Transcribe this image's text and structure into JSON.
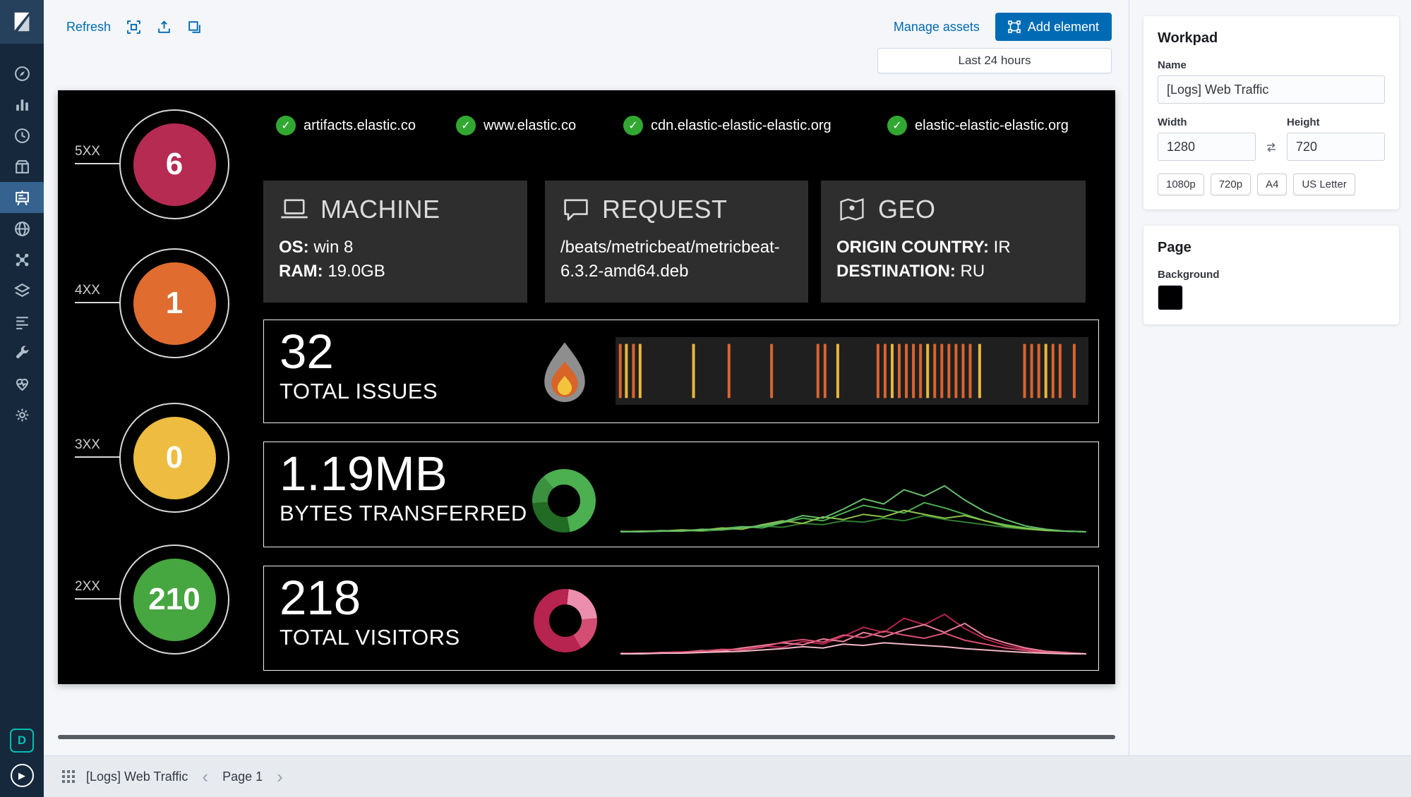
{
  "toolbar": {
    "refresh_label": "Refresh",
    "manage_assets_label": "Manage assets",
    "add_element_label": "Add element",
    "time_filter_label": "Last 24 hours"
  },
  "sidebar": {
    "space_badge": "D",
    "icons": [
      "kibana-logo",
      "discover-compass",
      "visualize-bar-chart",
      "uptime-clock",
      "apm-package",
      "canvas-easel",
      "maps-globe",
      "machine-learning-nodes",
      "infrastructure-layers",
      "logs-lines",
      "dev-tools-wrench",
      "monitoring-heartbeat",
      "management-gear",
      "space-badge-d",
      "play-presentation"
    ]
  },
  "workpad": {
    "status_gauges": [
      {
        "label": "5XX",
        "value": "6",
        "color": "#b62b51"
      },
      {
        "label": "4XX",
        "value": "1",
        "color": "#e06c30"
      },
      {
        "label": "3XX",
        "value": "0",
        "color": "#edbc40"
      },
      {
        "label": "2XX",
        "value": "210",
        "color": "#46a63f"
      }
    ],
    "endpoints": [
      {
        "label": "artifacts.elastic.co"
      },
      {
        "label": "www.elastic.co"
      },
      {
        "label": "cdn.elastic-elastic-elastic.org"
      },
      {
        "label": "elastic-elastic-elastic.org"
      }
    ],
    "cards": [
      {
        "title": "MACHINE",
        "icon": "laptop-icon",
        "lines": [
          {
            "label": "OS:",
            "value": " win 8"
          },
          {
            "label": "RAM:",
            "value": " 19.0GB"
          }
        ]
      },
      {
        "title": "REQUEST",
        "icon": "comment-icon",
        "lines": [
          {
            "label": "",
            "value": "/beats/metricbeat/metricbeat-6.3.2-amd64.deb"
          }
        ]
      },
      {
        "title": "GEO",
        "icon": "map-pin-icon",
        "lines": [
          {
            "label": "ORIGIN COUNTRY:",
            "value": " IR"
          },
          {
            "label": "DESTINATION:",
            "value": " RU"
          }
        ]
      }
    ],
    "metrics": [
      {
        "value": "32",
        "label": "TOTAL ISSUES"
      },
      {
        "value": "1.19MB",
        "label": "BYTES TRANSFERRED"
      },
      {
        "value": "218",
        "label": "TOTAL VISITORS"
      }
    ],
    "bytes_donut": {
      "start_deg": 320,
      "segments": [
        {
          "color": "#4caf50",
          "pct": 58
        },
        {
          "color": "#226b25",
          "pct": 27
        },
        {
          "color": "#3c9140",
          "pct": 15
        }
      ]
    },
    "visitors_donut": {
      "start_deg": 150,
      "segments": [
        {
          "color": "#b6244f",
          "pct": 60
        },
        {
          "color": "#ec8fae",
          "pct": 22
        },
        {
          "color": "#d34e72",
          "pct": 18
        }
      ]
    }
  },
  "right_panel": {
    "workpad_section": {
      "title": "Workpad",
      "name_label": "Name",
      "name_value": "[Logs] Web Traffic",
      "width_label": "Width",
      "width_value": "1280",
      "height_label": "Height",
      "height_value": "720",
      "presets": [
        "1080p",
        "720p",
        "A4",
        "US Letter"
      ]
    },
    "page_section": {
      "title": "Page",
      "background_label": "Background",
      "background_color": "#000000"
    }
  },
  "bottom_bar": {
    "workpad_title": "[Logs] Web Traffic",
    "page_label": "Page 1"
  },
  "chart_data": [
    {
      "type": "bar",
      "title": "HTTP status code counts",
      "categories": [
        "5XX",
        "4XX",
        "3XX",
        "2XX"
      ],
      "values": [
        6,
        1,
        0,
        210
      ]
    },
    {
      "type": "event-ticks",
      "title": "Total issues over last 24 hours",
      "total": 32,
      "x_range_pct": [
        0,
        100
      ],
      "events": [
        {
          "x": 1.0,
          "color": "#d9642e"
        },
        {
          "x": 2.3,
          "color": "#e9b63c"
        },
        {
          "x": 3.8,
          "color": "#d9642e"
        },
        {
          "x": 5.2,
          "color": "#e9b63c"
        },
        {
          "x": 16.5,
          "color": "#e9b63c"
        },
        {
          "x": 24.0,
          "color": "#d9642e"
        },
        {
          "x": 33.0,
          "color": "#d9642e"
        },
        {
          "x": 42.8,
          "color": "#d9642e"
        },
        {
          "x": 44.3,
          "color": "#d9642e"
        },
        {
          "x": 47.0,
          "color": "#e9b63c"
        },
        {
          "x": 55.5,
          "color": "#d9642e"
        },
        {
          "x": 57.0,
          "color": "#d9642e"
        },
        {
          "x": 58.5,
          "color": "#e9b63c"
        },
        {
          "x": 60.0,
          "color": "#d9642e"
        },
        {
          "x": 61.5,
          "color": "#d9642e"
        },
        {
          "x": 63.0,
          "color": "#d9642e"
        },
        {
          "x": 64.5,
          "color": "#d9642e"
        },
        {
          "x": 66.0,
          "color": "#e9b63c"
        },
        {
          "x": 67.5,
          "color": "#d9642e"
        },
        {
          "x": 69.0,
          "color": "#d9642e"
        },
        {
          "x": 70.5,
          "color": "#d9642e"
        },
        {
          "x": 72.0,
          "color": "#d9642e"
        },
        {
          "x": 73.5,
          "color": "#d9642e"
        },
        {
          "x": 75.0,
          "color": "#d9642e"
        },
        {
          "x": 77.0,
          "color": "#e9b63c"
        },
        {
          "x": 86.5,
          "color": "#d9642e"
        },
        {
          "x": 88.0,
          "color": "#d9642e"
        },
        {
          "x": 89.5,
          "color": "#d9642e"
        },
        {
          "x": 91.0,
          "color": "#e9b63c"
        },
        {
          "x": 92.5,
          "color": "#d9642e"
        },
        {
          "x": 94.0,
          "color": "#d9642e"
        },
        {
          "x": 97.0,
          "color": "#d9642e"
        }
      ]
    },
    {
      "type": "line",
      "title": "Bytes transferred over last 24 hours",
      "total": "1.19MB",
      "ylim": [
        0,
        100
      ],
      "series": [
        {
          "name": "dark-green",
          "color": "#2f7d31",
          "values": [
            1,
            2,
            2,
            3,
            2,
            4,
            6,
            10,
            8,
            14,
            12,
            18,
            16,
            22,
            18,
            26,
            20,
            16,
            12,
            8,
            5,
            3,
            2,
            1
          ]
        },
        {
          "name": "green",
          "color": "#4caf50",
          "values": [
            2,
            1,
            3,
            2,
            4,
            6,
            9,
            7,
            15,
            22,
            18,
            30,
            42,
            36,
            30,
            46,
            38,
            28,
            18,
            12,
            7,
            4,
            2,
            1
          ]
        },
        {
          "name": "yellow-green",
          "color": "#8bc34a",
          "values": [
            1,
            2,
            2,
            4,
            3,
            7,
            5,
            12,
            18,
            14,
            24,
            20,
            28,
            24,
            34,
            28,
            22,
            26,
            18,
            10,
            6,
            3,
            2,
            1
          ]
        },
        {
          "name": "bright-green",
          "color": "#66bb6a",
          "values": [
            1,
            1,
            2,
            2,
            5,
            4,
            8,
            10,
            16,
            26,
            22,
            36,
            52,
            44,
            66,
            56,
            72,
            50,
            32,
            20,
            10,
            5,
            2,
            1
          ]
        }
      ]
    },
    {
      "type": "line",
      "title": "Total visitors over last 24 hours",
      "total": 218,
      "ylim": [
        0,
        100
      ],
      "series": [
        {
          "name": "crimson",
          "color": "#b6244f",
          "values": [
            2,
            2,
            3,
            4,
            5,
            7,
            9,
            13,
            11,
            20,
            16,
            28,
            42,
            34,
            56,
            46,
            62,
            40,
            24,
            14,
            8,
            4,
            2,
            1
          ]
        },
        {
          "name": "light-pink",
          "color": "#e8829b",
          "values": [
            1,
            2,
            2,
            3,
            6,
            5,
            10,
            14,
            18,
            15,
            24,
            20,
            34,
            27,
            38,
            46,
            34,
            48,
            28,
            18,
            10,
            5,
            3,
            1
          ]
        },
        {
          "name": "rose",
          "color": "#d94f70",
          "values": [
            2,
            1,
            3,
            3,
            5,
            8,
            7,
            11,
            19,
            23,
            19,
            30,
            26,
            36,
            30,
            25,
            33,
            22,
            16,
            10,
            6,
            3,
            2,
            1
          ]
        },
        {
          "name": "pale-pink",
          "color": "#f2b8c6",
          "values": [
            1,
            1,
            2,
            2,
            3,
            4,
            5,
            7,
            9,
            12,
            10,
            16,
            14,
            18,
            16,
            14,
            12,
            9,
            7,
            5,
            3,
            2,
            1,
            1
          ]
        }
      ]
    }
  ]
}
